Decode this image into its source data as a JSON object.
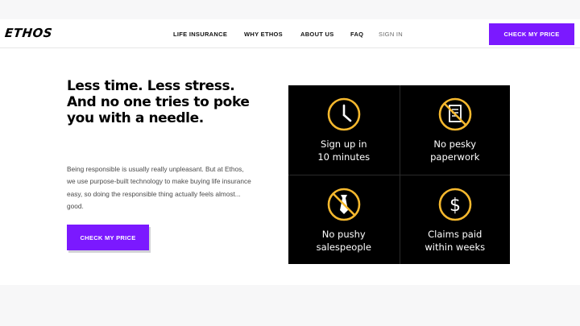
{
  "brand": {
    "logo": "ETHOS",
    "accent_color": "#7b19ff"
  },
  "nav": {
    "items": [
      {
        "label": "LIFE INSURANCE"
      },
      {
        "label": "WHY ETHOS"
      },
      {
        "label": "ABOUT US"
      },
      {
        "label": "FAQ"
      },
      {
        "label": "SIGN IN"
      }
    ],
    "cta_label": "CHECK MY PRICE"
  },
  "hero": {
    "headline_lines": [
      "Less time. Less stress.",
      "And no one tries to poke",
      "you with a needle."
    ],
    "body": "Being responsible is usually really unpleasant. But at Ethos, we use purpose-built technology to make buying life insurance easy, so doing the responsible thing actually feels almost... good.",
    "cta_label": "CHECK MY PRICE"
  },
  "features": [
    {
      "icon": "clock-icon",
      "label": "Sign up in\n10 minutes"
    },
    {
      "icon": "no-paperwork-icon",
      "label": "No pesky\npaperwork"
    },
    {
      "icon": "no-salesperson-tie-icon",
      "label": "No pushy\nsalespeople"
    },
    {
      "icon": "dollar-icon",
      "label": "Claims paid\nwithin weeks"
    }
  ],
  "icon_color": "#f5b82e"
}
